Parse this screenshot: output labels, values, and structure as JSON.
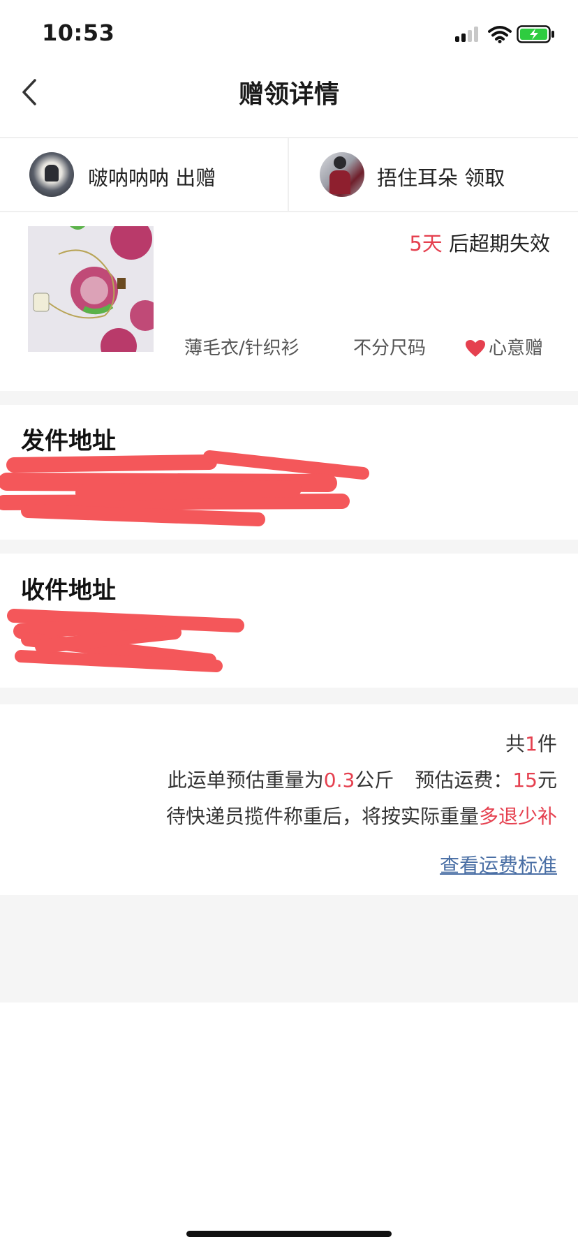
{
  "status_bar": {
    "time": "10:53",
    "signal_bars": 2,
    "battery": "charging"
  },
  "nav": {
    "title": "赠领详情",
    "back_icon": "chevron-left-icon"
  },
  "giver": {
    "name": "啵呐呐呐",
    "role": "出赠"
  },
  "receiver": {
    "name": "捂住耳朵",
    "role": "领取"
  },
  "product": {
    "expiry_days": "5天",
    "expiry_suffix": "后超期失效",
    "category": "薄毛衣/针织衫",
    "size": "不分尺码",
    "tag": "心意赠",
    "tag_icon": "heart-icon"
  },
  "sender_address": {
    "title": "发件地址"
  },
  "receiver_address": {
    "title": "收件地址"
  },
  "summary": {
    "count_prefix": "共",
    "count": "1",
    "count_suffix": "件",
    "weight_prefix": "此运单预估重量为",
    "weight": "0.3",
    "weight_unit": "公斤",
    "fee_prefix": "预估运费：",
    "fee": "15",
    "fee_unit": "元",
    "note_prefix": "待快递员揽件称重后，将按实际重量",
    "note_highlight": "多退少补",
    "link": "查看运费标准"
  },
  "colors": {
    "accent_red": "#e5404f",
    "link_blue": "#4a6fa5",
    "redaction": "#f4575a",
    "separator": "#f5f5f5"
  }
}
